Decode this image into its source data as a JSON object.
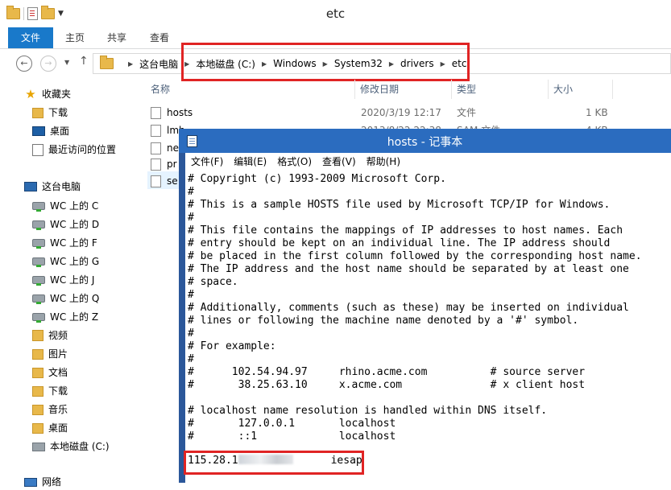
{
  "explorer": {
    "window_title": "etc",
    "ribbon_tabs": [
      "文件",
      "主页",
      "共享",
      "查看"
    ],
    "breadcrumbs": [
      "这台电脑",
      "本地磁盘 (C:)",
      "Windows",
      "System32",
      "drivers",
      "etc"
    ],
    "nav": {
      "favorites": "收藏夹",
      "fav_items": [
        "下载",
        "桌面",
        "最近访问的位置"
      ],
      "this_pc": "这台电脑",
      "pc_items": [
        "WC 上的 C",
        "WC 上的 D",
        "WC 上的 F",
        "WC 上的 G",
        "WC 上的 J",
        "WC 上的 Q",
        "WC 上的 Z",
        "视频",
        "图片",
        "文档",
        "下载",
        "音乐",
        "桌面",
        "本地磁盘 (C:)"
      ],
      "network": "网络"
    },
    "columns": [
      "名称",
      "修改日期",
      "类型",
      "大小"
    ],
    "files": [
      {
        "name": "hosts",
        "date": "2020/3/19 12:17",
        "type": "文件",
        "size": "1 KB"
      },
      {
        "name": "lmh",
        "date": "2013/8/22 22:38",
        "type": "SAM 文件",
        "size": "4 KB"
      },
      {
        "name": "ne",
        "date": "",
        "type": "",
        "size": ""
      },
      {
        "name": "pr",
        "date": "",
        "type": "",
        "size": ""
      },
      {
        "name": "se",
        "date": "",
        "type": "",
        "size": ""
      }
    ]
  },
  "notepad": {
    "title": "hosts - 记事本",
    "menu": [
      "文件(F)",
      "编辑(E)",
      "格式(O)",
      "查看(V)",
      "帮助(H)"
    ],
    "content": "# Copyright (c) 1993-2009 Microsoft Corp.\n#\n# This is a sample HOSTS file used by Microsoft TCP/IP for Windows.\n#\n# This file contains the mappings of IP addresses to host names. Each\n# entry should be kept on an individual line. The IP address should\n# be placed in the first column followed by the corresponding host name.\n# The IP address and the host name should be separated by at least one\n# space.\n#\n# Additionally, comments (such as these) may be inserted on individual\n# lines or following the machine name denoted by a '#' symbol.\n#\n# For example:\n#\n#      102.54.94.97     rhino.acme.com          # source server\n#       38.25.63.10     x.acme.com              # x client host\n\n# localhost name resolution is handled within DNS itself.\n#\t127.0.0.1       localhost\n#\t::1             localhost",
    "added_entry_ip": "115.28.1",
    "added_entry_host": "iesap"
  }
}
